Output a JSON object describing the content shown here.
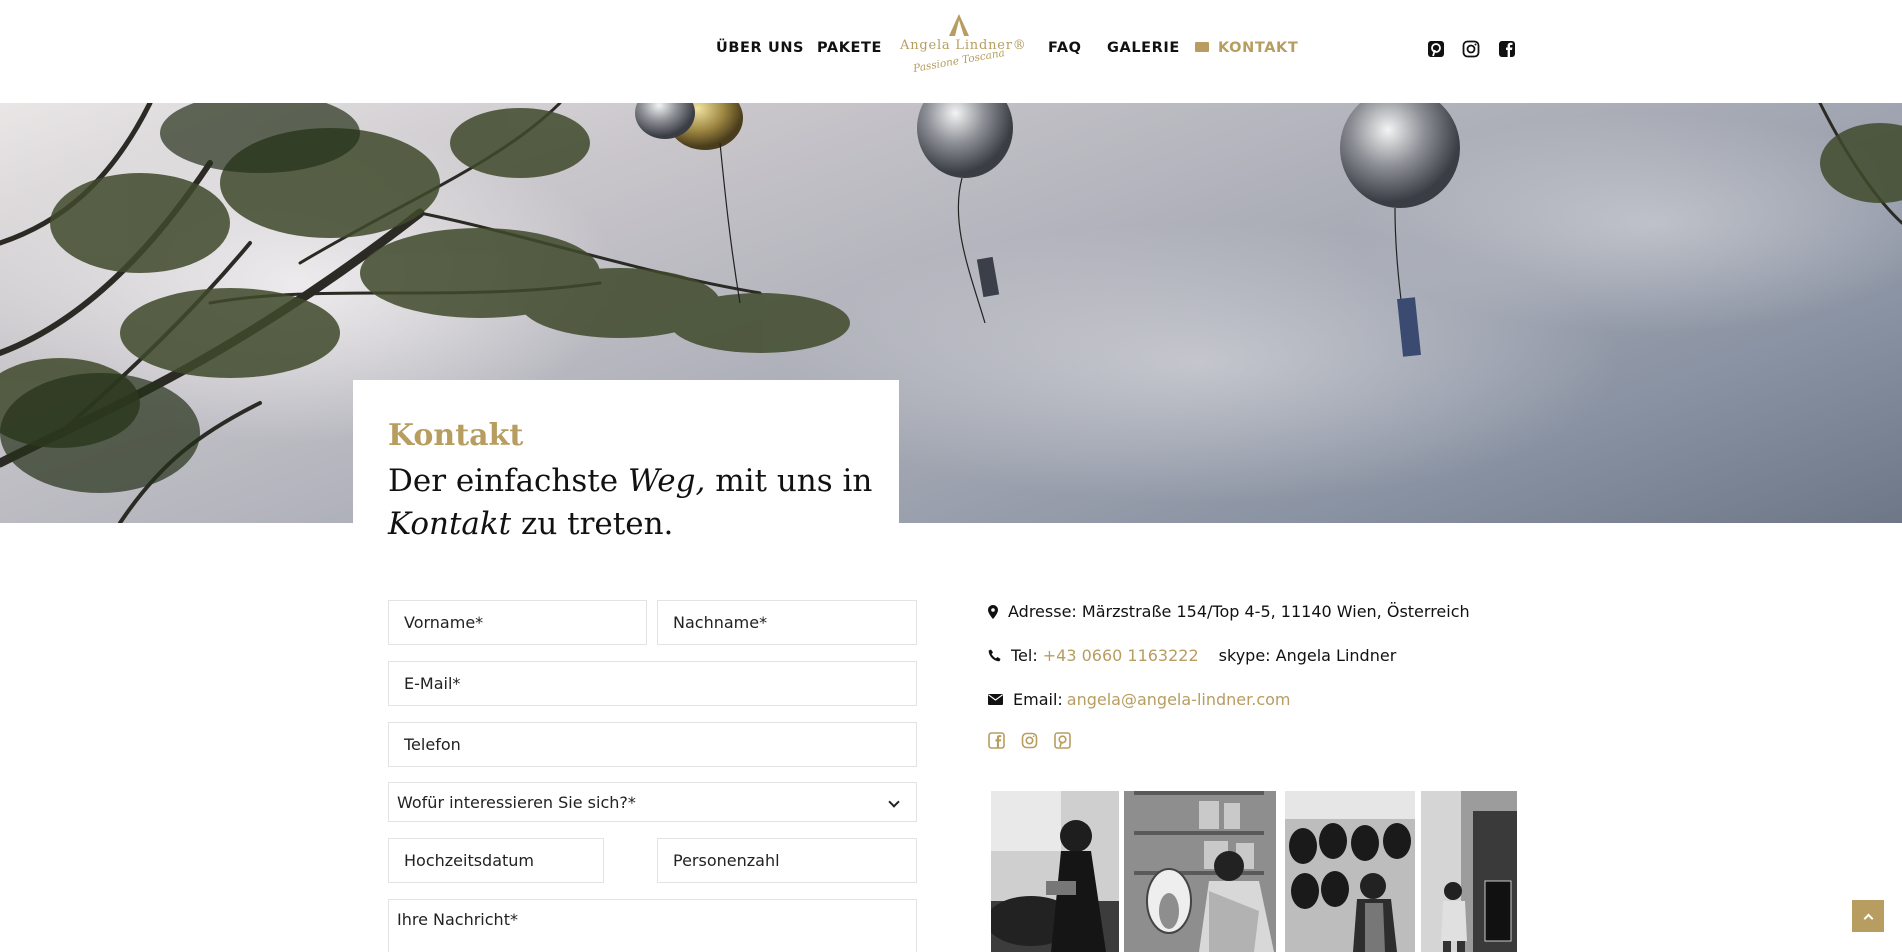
{
  "nav": {
    "left": [
      "ÜBER UNS",
      "PAKETE"
    ],
    "right": [
      "FAQ",
      "GALERIE",
      "KONTAKT"
    ]
  },
  "logo": {
    "name": "Angela Lindner®",
    "tagline": "Passione Toscana"
  },
  "social_top": [
    "pinterest-icon",
    "instagram-icon",
    "facebook-icon"
  ],
  "hero": {
    "kicker": "Kontakt",
    "title_part1": "Der einfachste ",
    "title_em1": "Weg,",
    "title_part2": " mit uns in ",
    "title_em2": "Kontakt",
    "title_part3": " zu treten."
  },
  "form": {
    "firstname": "Vorname*",
    "lastname": "Nachname*",
    "email": "E-Mail*",
    "phone": "Telefon",
    "interest": "Wofür interessieren Sie sich?*",
    "wedding_date": "Hochzeitsdatum",
    "guests": "Personenzahl",
    "message": "Ihre Nachricht*"
  },
  "contact": {
    "address_label": "Adresse: Märzstraße 154/Top 4-5, 11140 Wien, Österreich",
    "tel_label": "Tel:",
    "tel_value": "+43 0660 1163222",
    "skype": "skype: Angela Lindner",
    "email_label": "Email:",
    "email_value": "angela@angela-lindner.com"
  },
  "social_small": [
    "facebook-icon",
    "instagram-icon",
    "pinterest-icon"
  ],
  "colors": {
    "accent": "#b79d5f",
    "text": "#111111",
    "border": "#e3e3e3"
  }
}
